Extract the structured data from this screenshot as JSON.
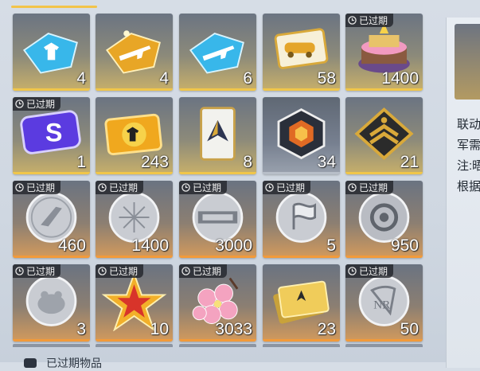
{
  "expired_label": "已过期",
  "section_label": "已过期物品",
  "right_panel": {
    "lines": [
      "联动",
      "军需",
      "注:晤",
      "根据"
    ]
  },
  "items": [
    {
      "qty": "4",
      "expired": false,
      "tier": "gold",
      "icon": "blue-puzzle-shirt-icon"
    },
    {
      "qty": "4",
      "expired": false,
      "tier": "gold",
      "icon": "gold-puzzle-rifle-icon"
    },
    {
      "qty": "6",
      "expired": false,
      "tier": "gold",
      "icon": "blue-puzzle-rifle-icon"
    },
    {
      "qty": "58",
      "expired": false,
      "tier": "gold",
      "icon": "gold-car-ticket-icon"
    },
    {
      "qty": "1400",
      "expired": true,
      "tier": "gold",
      "icon": "birthday-cake-icon"
    },
    {
      "qty": "1",
      "expired": true,
      "tier": "gold",
      "icon": "purple-s-card-icon"
    },
    {
      "qty": "243",
      "expired": false,
      "tier": "gold",
      "icon": "gold-shirt-ticket-icon"
    },
    {
      "qty": "8",
      "expired": false,
      "tier": "gold",
      "icon": "supply-card-icon"
    },
    {
      "qty": "34",
      "expired": false,
      "tier": "gray",
      "icon": "red-hexagon-badge-icon"
    },
    {
      "qty": "21",
      "expired": false,
      "tier": "gold",
      "icon": "rank-chevron-icon"
    },
    {
      "qty": "460",
      "expired": true,
      "tier": "orange",
      "icon": "silver-coin-emblem-icon"
    },
    {
      "qty": "1400",
      "expired": true,
      "tier": "orange",
      "icon": "silver-coin-fireworks-icon"
    },
    {
      "qty": "3000",
      "expired": true,
      "tier": "orange",
      "icon": "silver-coin-text-icon"
    },
    {
      "qty": "5",
      "expired": true,
      "tier": "orange",
      "icon": "silver-coin-flag-icon"
    },
    {
      "qty": "950",
      "expired": true,
      "tier": "orange",
      "icon": "silver-coin-knot-icon"
    },
    {
      "qty": "3",
      "expired": true,
      "tier": "orange",
      "icon": "silver-coin-frog-icon"
    },
    {
      "qty": "10",
      "expired": true,
      "tier": "orange",
      "icon": "red-gold-star-icon"
    },
    {
      "qty": "3033",
      "expired": true,
      "tier": "orange",
      "icon": "cherry-blossom-icon"
    },
    {
      "qty": "23",
      "expired": false,
      "tier": "orange",
      "icon": "gold-ticket-stack-icon"
    },
    {
      "qty": "50",
      "expired": true,
      "tier": "orange",
      "icon": "silver-coin-nerv-icon"
    }
  ]
}
